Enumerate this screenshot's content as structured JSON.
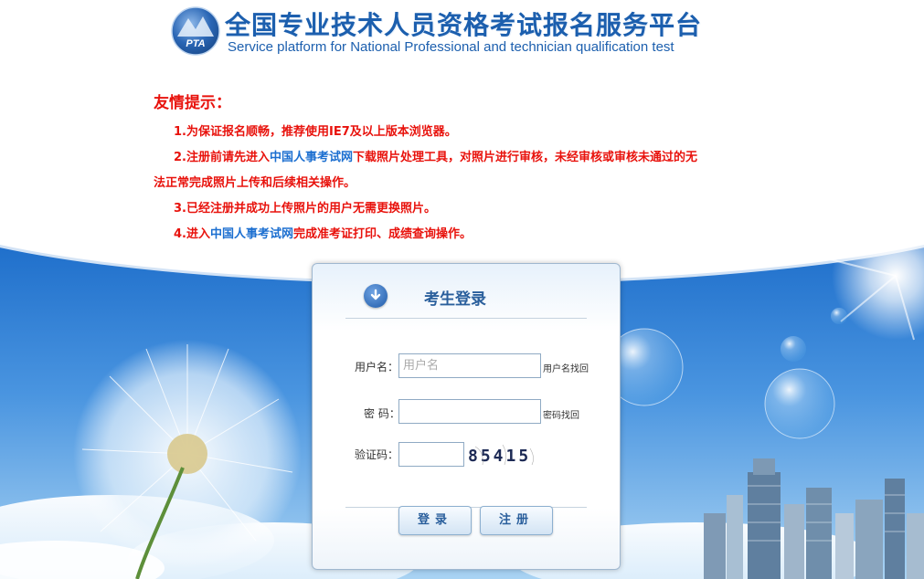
{
  "header": {
    "title_cn": "全国专业技术人员资格考试报名服务平台",
    "title_en": "Service platform for National Professional and technician qualification test",
    "logo_text": "PTA"
  },
  "notice": {
    "title": "友情提示：",
    "line1": "1.为保证报名顺畅，推荐使用IE7及以上版本浏览器。",
    "line2_pre": "2.注册前请先进入",
    "line2_link": "中国人事考试网",
    "line2_post": "下载照片处理工具，对照片进行审核，未经审核或审核未通过的无",
    "line2_cont": "法正常完成照片上传和后续相关操作。",
    "line3": "3.已经注册并成功上传照片的用户无需更换照片。",
    "line4_pre": "4.进入",
    "line4_link": "中国人事考试网",
    "line4_post": "完成准考证打印、成绩查询操作。"
  },
  "login": {
    "title": "考生登录",
    "username_label": "用户名：",
    "username_placeholder": "用户名",
    "username_value": "",
    "username_recover": "用户名找回",
    "password_label": "密 码：",
    "password_value": "",
    "password_recover": "密码找回",
    "captcha_label": "验证码：",
    "captcha_value": "",
    "captcha_text": "85415",
    "login_button": "登录",
    "register_button": "注册"
  },
  "colors": {
    "brand_blue": "#1c5fae",
    "notice_red": "#e8120c",
    "link_blue": "#1c6fd0",
    "sky_blue": "#2f7fd6"
  }
}
